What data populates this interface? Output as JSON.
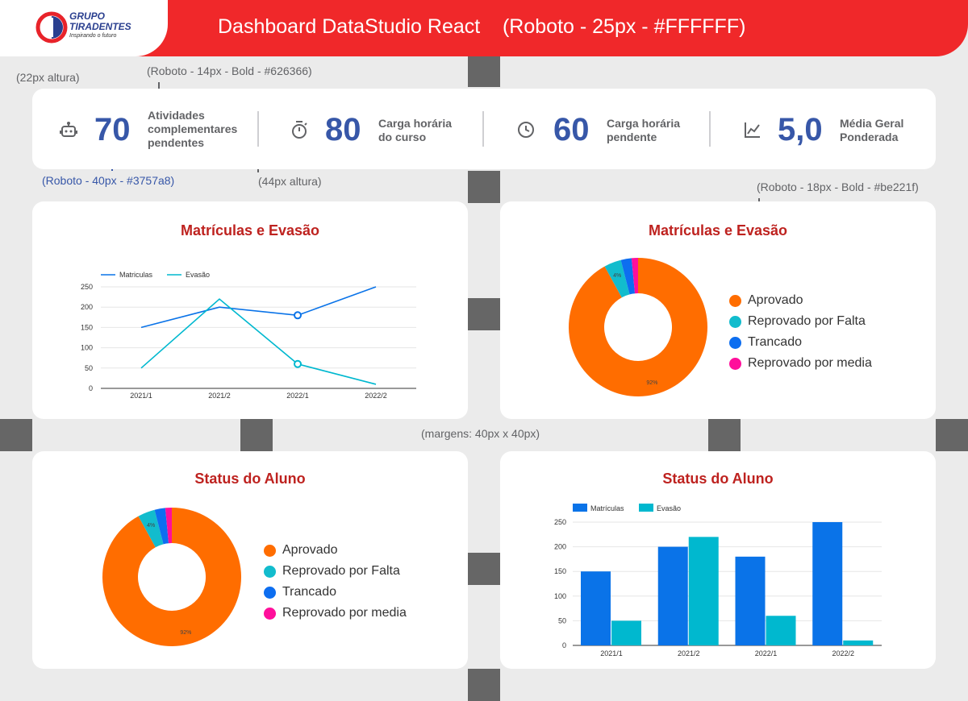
{
  "header": {
    "logo_line1": "GRUPO",
    "logo_line2": "TIRADENTES",
    "logo_tagline": "Inspirando o futuro",
    "title": "Dashboard DataStudio React    (Roboto - 25px - #FFFFFF)"
  },
  "annotations": {
    "icon_height": "(22px altura)",
    "label_style": "(Roboto - 14px - Bold - #626366)",
    "value_style": "(Roboto - 40px - #3757a8)",
    "divider_height": "(44px altura)",
    "title_style": "(Roboto - 18px - Bold - #be221f)",
    "margins": "(margens: 40px x 40px)"
  },
  "kpis": [
    {
      "icon": "robot-icon",
      "value": "70",
      "label_lines": [
        "Atividades",
        "complementares",
        "pendentes"
      ]
    },
    {
      "icon": "stopwatch-icon",
      "value": "80",
      "label_lines": [
        "Carga horária",
        "do curso"
      ]
    },
    {
      "icon": "clock-icon",
      "value": "60",
      "label_lines": [
        "Carga horária",
        "pendente"
      ]
    },
    {
      "icon": "trending-icon",
      "value": "5,0",
      "label_lines": [
        "Média Geral",
        "Ponderada"
      ]
    }
  ],
  "colors": {
    "header": "#f0282a",
    "value": "#3757a8",
    "label": "#626366",
    "chart_title": "#be221f",
    "matriculas": "#0a73e8",
    "evasao": "#00b8cf",
    "aprovado": "#ff6d00",
    "reprovado_falta": "#12bccd",
    "trancado": "#0d6ef0",
    "reprovado_media": "#ff0f9b"
  },
  "cards": {
    "line_title": "Matrículas e Evasão",
    "donut1_title": "Matrículas e Evasão",
    "donut2_title": "Status do Aluno",
    "bar_title": "Status do Aluno"
  },
  "chart_data": [
    {
      "type": "line",
      "categories": [
        "2021/1",
        "2021/2",
        "2022/1",
        "2022/2"
      ],
      "series": [
        {
          "name": "Matriculas",
          "values": [
            150,
            200,
            180,
            250
          ]
        },
        {
          "name": "Evasão",
          "values": [
            50,
            220,
            60,
            10
          ]
        }
      ],
      "yticks": [
        "0",
        "50",
        "100",
        "150",
        "200",
        "250"
      ],
      "ylim": [
        0,
        250
      ],
      "grid": true,
      "legend": "top-left"
    },
    {
      "type": "pie",
      "labels": [
        "Aprovado",
        "Reprovado por Falta",
        "Trancado",
        "Reprovado por media"
      ],
      "values": [
        92,
        4,
        2.5,
        1.5
      ],
      "data_labels": [
        "92%",
        "4%",
        "",
        ""
      ],
      "legend": "right"
    },
    {
      "type": "pie",
      "labels": [
        "Aprovado",
        "Reprovado por Falta",
        "Trancado",
        "Reprovado por media"
      ],
      "values": [
        92,
        4,
        2.5,
        1.5
      ],
      "data_labels": [
        "92%",
        "4%",
        "",
        ""
      ],
      "legend": "right"
    },
    {
      "type": "bar",
      "categories": [
        "2021/1",
        "2021/2",
        "2022/1",
        "2022/2"
      ],
      "series": [
        {
          "name": "Matrículas",
          "values": [
            150,
            200,
            180,
            250
          ]
        },
        {
          "name": "Evasão",
          "values": [
            50,
            220,
            60,
            10
          ]
        }
      ],
      "yticks": [
        "0",
        "50",
        "100",
        "150",
        "200",
        "250"
      ],
      "ylim": [
        0,
        250
      ],
      "grid": true,
      "legend": "top-left"
    }
  ]
}
